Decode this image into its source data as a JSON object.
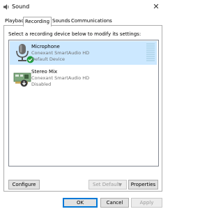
{
  "window": {
    "title": "Sound"
  },
  "tabs": [
    {
      "label": "Playback",
      "active": false
    },
    {
      "label": "Recording",
      "active": true
    },
    {
      "label": "Sounds",
      "active": false
    },
    {
      "label": "Communications",
      "active": false
    }
  ],
  "instruction": "Select a recording device below to modify its settings:",
  "devices": [
    {
      "name": "Microphone",
      "driver": "Conexant SmartAudio HD",
      "status": "Default Device",
      "selected": true,
      "icon": "microphone-icon",
      "badge": "default-check-icon"
    },
    {
      "name": "Stereo Mix",
      "driver": "Conexant SmartAudio HD",
      "status": "Disabled",
      "selected": false,
      "icon": "sound-card-icon",
      "badge": "disabled-arrow-icon"
    }
  ],
  "buttons": {
    "configure": "Configure",
    "set_default": "Set Default",
    "properties": "Properties",
    "ok": "OK",
    "cancel": "Cancel",
    "apply": "Apply"
  },
  "colors": {
    "selection": "#cce8ff",
    "accent": "#0078d7",
    "check_green": "#1f9d3a"
  }
}
